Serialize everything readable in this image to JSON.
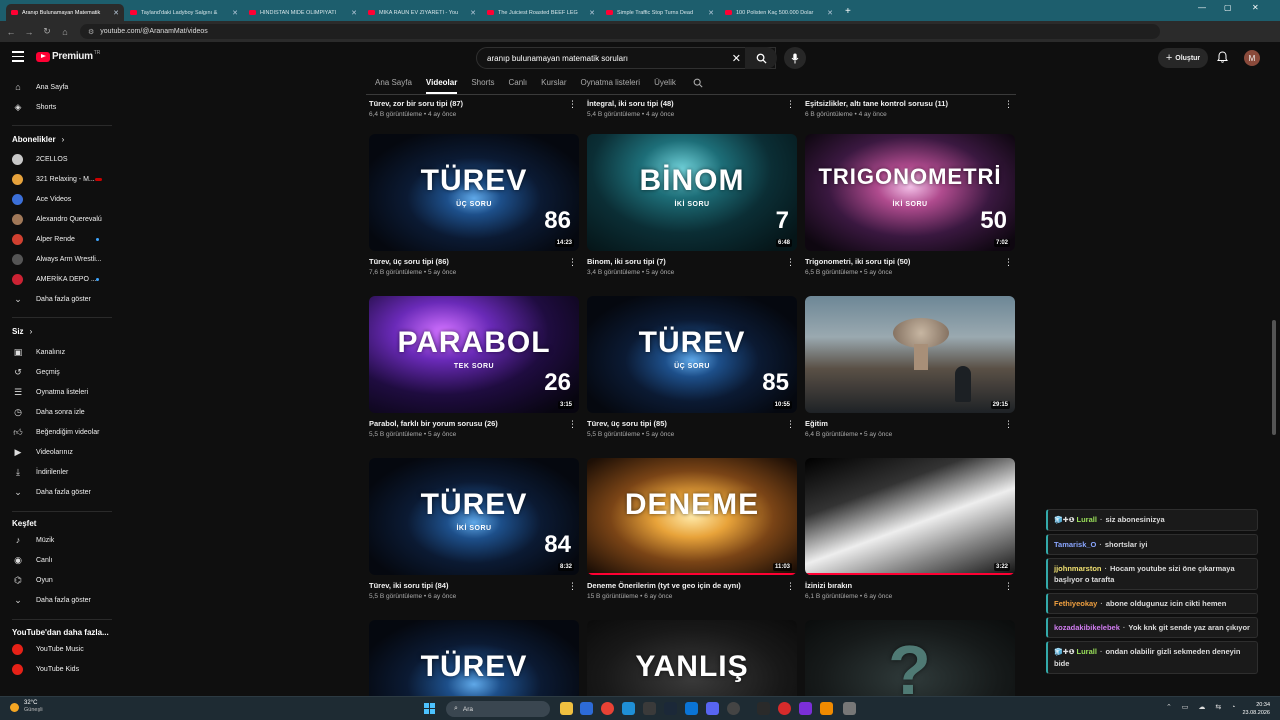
{
  "browser": {
    "tabs": [
      {
        "label": "Aranıp Bulunamayan Matematik",
        "active": true
      },
      {
        "label": "Tayland'daki Ladyboy Salgını &",
        "active": false
      },
      {
        "label": "HİNDİSTAN MİDE OLİMPİYATI",
        "active": false
      },
      {
        "label": "MİKA RAUN EV ZİYARETİ - You",
        "active": false
      },
      {
        "label": "The Juiciest Roasted BEEF LEG",
        "active": false
      },
      {
        "label": "Simple Traffic Stop Turns Dead",
        "active": false
      },
      {
        "label": "100 Polisten Kaç 500.000 Dolar",
        "active": false
      }
    ],
    "url": "youtube.com/@AranamMat/videos"
  },
  "header": {
    "logo_text": "Premium",
    "logo_region": "TR",
    "search_value": "aranıp bulunamayan matematik soruları",
    "create_label": "Oluştur",
    "avatar_letter": "M"
  },
  "sidebar": {
    "top": [
      {
        "label": "Ana Sayfa",
        "icon": "home-icon"
      },
      {
        "label": "Shorts",
        "icon": "shorts-icon"
      }
    ],
    "subs_title": "Abonelikler",
    "subs": [
      {
        "label": "2CELLOS",
        "color": "#c8c8c8",
        "badge": ""
      },
      {
        "label": "321 Relaxing - M...",
        "color": "#e6a23c",
        "badge": "live"
      },
      {
        "label": "Ace Videos",
        "color": "#3b6fd8",
        "badge": ""
      },
      {
        "label": "Alexandro Querevalú",
        "color": "#a07858",
        "badge": ""
      },
      {
        "label": "Alper Rende",
        "color": "#d04030",
        "badge": "dot"
      },
      {
        "label": "Always Arm Wrestli...",
        "color": "#555555",
        "badge": ""
      },
      {
        "label": "AMERİKA DEPO ...",
        "color": "#cc2233",
        "badge": "dot"
      }
    ],
    "subs_more": "Daha fazla göster",
    "you_title": "Siz",
    "you": [
      {
        "label": "Kanalınız",
        "icon": "channel-icon"
      },
      {
        "label": "Geçmiş",
        "icon": "history-icon"
      },
      {
        "label": "Oynatma listeleri",
        "icon": "playlist-icon"
      },
      {
        "label": "Daha sonra izle",
        "icon": "watch-later-icon"
      },
      {
        "label": "Beğendiğim videolar",
        "icon": "like-icon"
      },
      {
        "label": "Videolarınız",
        "icon": "your-videos-icon"
      },
      {
        "label": "İndirilenler",
        "icon": "download-icon"
      },
      {
        "label": "Daha fazla göster",
        "icon": "chevron-down-icon"
      }
    ],
    "explore_title": "Keşfet",
    "explore": [
      {
        "label": "Müzik",
        "icon": "music-icon"
      },
      {
        "label": "Canlı",
        "icon": "live-icon"
      },
      {
        "label": "Oyun",
        "icon": "gaming-icon"
      },
      {
        "label": "Daha fazla göster",
        "icon": "chevron-down-icon"
      }
    ],
    "more_title": "YouTube'dan daha fazla...",
    "more": [
      {
        "label": "YouTube Music"
      },
      {
        "label": "YouTube Kids"
      }
    ]
  },
  "channel_tabs": [
    "Ana Sayfa",
    "Videolar",
    "Shorts",
    "Canlı",
    "Kurslar",
    "Oynatma listeleri",
    "Üyelik"
  ],
  "videos": [
    {
      "title": "Türev, zor bir soru tipi (87)",
      "meta": "6,4 B görüntüleme • 4 ay önce",
      "thumb": null
    },
    {
      "title": "İntegral, iki soru tipi (48)",
      "meta": "5,4 B görüntüleme • 4 ay önce",
      "thumb": null
    },
    {
      "title": "Eşitsizlikler, altı tane kontrol sorusu (11)",
      "meta": "6 B görüntüleme • 4 ay önce",
      "thumb": null
    },
    {
      "title": "Türev, üç soru tipi (86)",
      "meta": "7,6 B görüntüleme • 5 ay önce",
      "thumb": {
        "big": "TÜREV",
        "sub": "ÜÇ SORU",
        "num": "86",
        "duration": "14:23",
        "style": "storm"
      }
    },
    {
      "title": "Binom, iki soru tipi (7)",
      "meta": "3,4 B görüntüleme • 5 ay önce",
      "thumb": {
        "big": "BİNOM",
        "sub": "İKİ SORU",
        "num": "7",
        "duration": "6:48",
        "style": "teal"
      }
    },
    {
      "title": "Trigonometri, iki soru tipi (50)",
      "meta": "6,5 B görüntüleme • 5 ay önce",
      "thumb": {
        "big": "TRIGONOMETRİ",
        "sub": "İKİ SORU",
        "num": "50",
        "duration": "7:02",
        "style": "nebula"
      }
    },
    {
      "title": "Parabol, farklı bir yorum sorusu (26)",
      "meta": "5,5 B görüntüleme • 5 ay önce",
      "thumb": {
        "big": "PARABOL",
        "sub": "TEK SORU",
        "num": "26",
        "duration": "3:15",
        "style": "purple"
      }
    },
    {
      "title": "Türev, üç soru tipi (85)",
      "meta": "5,5 B görüntüleme • 5 ay önce",
      "thumb": {
        "big": "TÜREV",
        "sub": "ÜÇ SORU",
        "num": "85",
        "duration": "10:55",
        "style": "storm"
      }
    },
    {
      "title": "Eğitim",
      "meta": "6,4 B görüntüleme • 5 ay önce",
      "thumb": {
        "big": "",
        "sub": "",
        "num": "",
        "duration": "29:15",
        "style": "cloud"
      }
    },
    {
      "title": "Türev, iki soru tipi (84)",
      "meta": "5,5 B görüntüleme • 6 ay önce",
      "thumb": {
        "big": "TÜREV",
        "sub": "İKİ SORU",
        "num": "84",
        "duration": "8:32",
        "style": "storm"
      }
    },
    {
      "title": "Deneme Önerilerim (tyt ve geo için de aynı)",
      "meta": "15 B görüntüleme • 6 ay önce",
      "thumb": {
        "big": "DENEME",
        "sub": "",
        "num": "",
        "duration": "11:03",
        "style": "gold",
        "progress": 1.0
      }
    },
    {
      "title": "İzinizi bırakın",
      "meta": "6,1 B görüntüleme • 6 ay önce",
      "thumb": {
        "big": "",
        "sub": "",
        "num": "",
        "duration": "3:22",
        "style": "guitar",
        "progress": 1.0
      }
    },
    {
      "title": "",
      "meta": "",
      "thumb": {
        "big": "TÜREV",
        "sub": "",
        "num": "",
        "duration": "",
        "style": "storm"
      }
    },
    {
      "title": "",
      "meta": "",
      "thumb": {
        "big": "YANLIŞ",
        "sub": "",
        "num": "",
        "duration": "",
        "style": "dark"
      }
    },
    {
      "title": "",
      "meta": "",
      "thumb": {
        "big": "?",
        "sub": "",
        "num": "",
        "duration": "",
        "style": "puzzle"
      }
    }
  ],
  "chat": [
    {
      "badges": "🧊✚❶",
      "user": "Lurall",
      "user_color": "#9ae05a",
      "text": "siz abonesinizya"
    },
    {
      "badges": "",
      "user": "Tamarisk_O",
      "user_color": "#8aa6ff",
      "text": "shortslar iyi"
    },
    {
      "badges": "",
      "user": "jjohnmarston",
      "user_color": "#f0e070",
      "text": "Hocam youtube sizi öne çıkarmaya başlıyor o tarafta"
    },
    {
      "badges": "",
      "user": "Fethiyeokay",
      "user_color": "#f0a040",
      "text": "abone oldugunuz icin cikti hemen"
    },
    {
      "badges": "",
      "user": "kozadakibikelebek",
      "user_color": "#d07cf0",
      "text": "Yok knk git sende yaz aran çıkıyor"
    },
    {
      "badges": "🧊✚❶",
      "user": "Lurall",
      "user_color": "#9ae05a",
      "text": "ondan olabilir gizli sekmeden deneyin bide"
    }
  ],
  "taskbar": {
    "weather_temp": "32°C",
    "weather_desc": "Güneşli",
    "search_placeholder": "Ara",
    "time": "20:34",
    "date": "23.08.2026"
  }
}
